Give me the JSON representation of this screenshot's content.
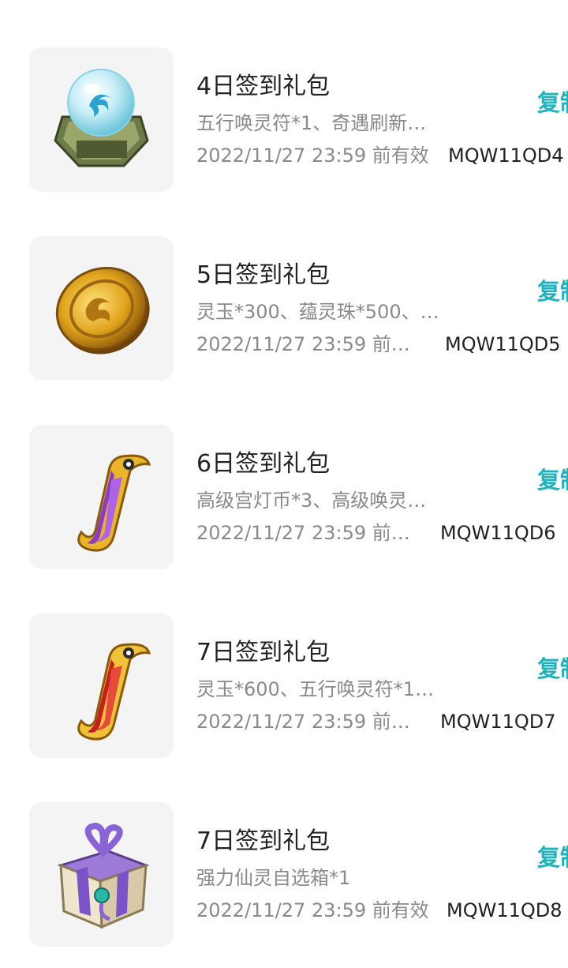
{
  "packages": [
    {
      "title": "4日签到礼包",
      "description": "五行唤灵符*1、奇遇刷新…",
      "expiry": "2022/11/27 23:59 前有效",
      "code": "MQW11QD4",
      "copy_label": "复制",
      "icon": "spirit-orb-icon"
    },
    {
      "title": "5日签到礼包",
      "description": "灵玉*300、蕴灵珠*500、…",
      "expiry": "2022/11/27 23:59 前…",
      "code": "MQW11QD5",
      "copy_label": "复制",
      "icon": "gold-coin-icon"
    },
    {
      "title": "6日签到礼包",
      "description": "高级宫灯币*3、高级唤灵…",
      "expiry": "2022/11/27 23:59 前…",
      "code": "MQW11QD6",
      "copy_label": "复制",
      "icon": "purple-scroll-icon"
    },
    {
      "title": "7日签到礼包",
      "description": "灵玉*600、五行唤灵符*1…",
      "expiry": "2022/11/27 23:59 前…",
      "code": "MQW11QD7",
      "copy_label": "复制",
      "icon": "red-scroll-icon"
    },
    {
      "title": "7日签到礼包",
      "description": "强力仙灵自选箱*1",
      "expiry": "2022/11/27 23:59 前有效",
      "code": "MQW11QD8",
      "copy_label": "复制",
      "icon": "gift-box-icon"
    }
  ]
}
